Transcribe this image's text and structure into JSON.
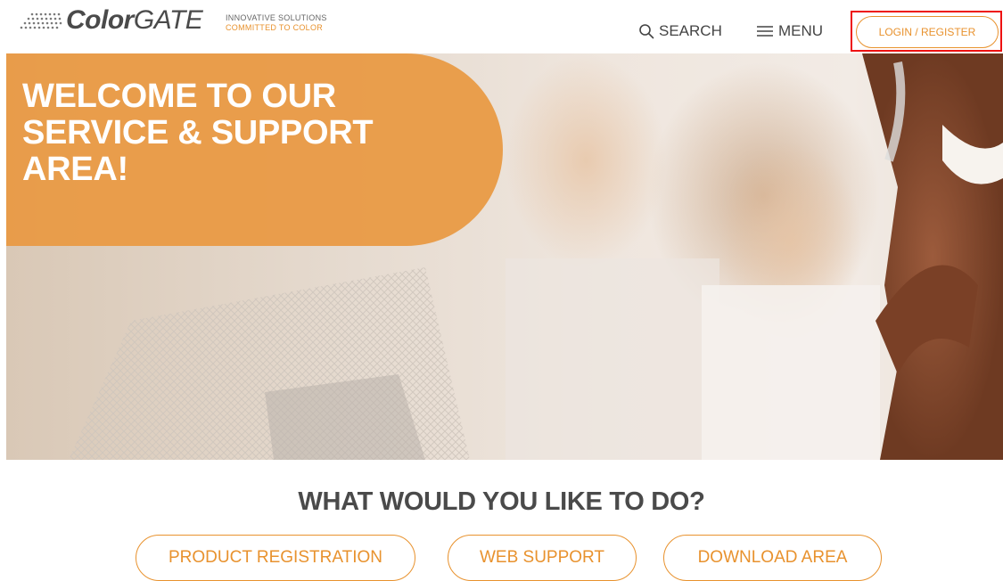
{
  "header": {
    "logo_bold": "Color",
    "logo_light": "GATE",
    "tagline_line1": "INNOVATIVE SOLUTIONS",
    "tagline_line2": "COMMITTED TO COLOR",
    "search_label": "SEARCH",
    "menu_label": "MENU",
    "login_label": "LOGIN / REGISTER"
  },
  "hero": {
    "title_lines": [
      "WELCOME TO OUR",
      "SERVICE & SUPPORT",
      "AREA!"
    ]
  },
  "main": {
    "question": "WHAT WOULD YOU LIKE TO DO?",
    "actions": [
      {
        "label": "PRODUCT REGISTRATION"
      },
      {
        "label": "WEB SUPPORT"
      },
      {
        "label": "DOWNLOAD AREA"
      }
    ]
  },
  "colors": {
    "accent": "#e8922e",
    "highlight": "#e11111",
    "text": "#4a4a4a"
  },
  "icons": [
    "search-icon",
    "menu-icon",
    "logo-dots-icon"
  ]
}
